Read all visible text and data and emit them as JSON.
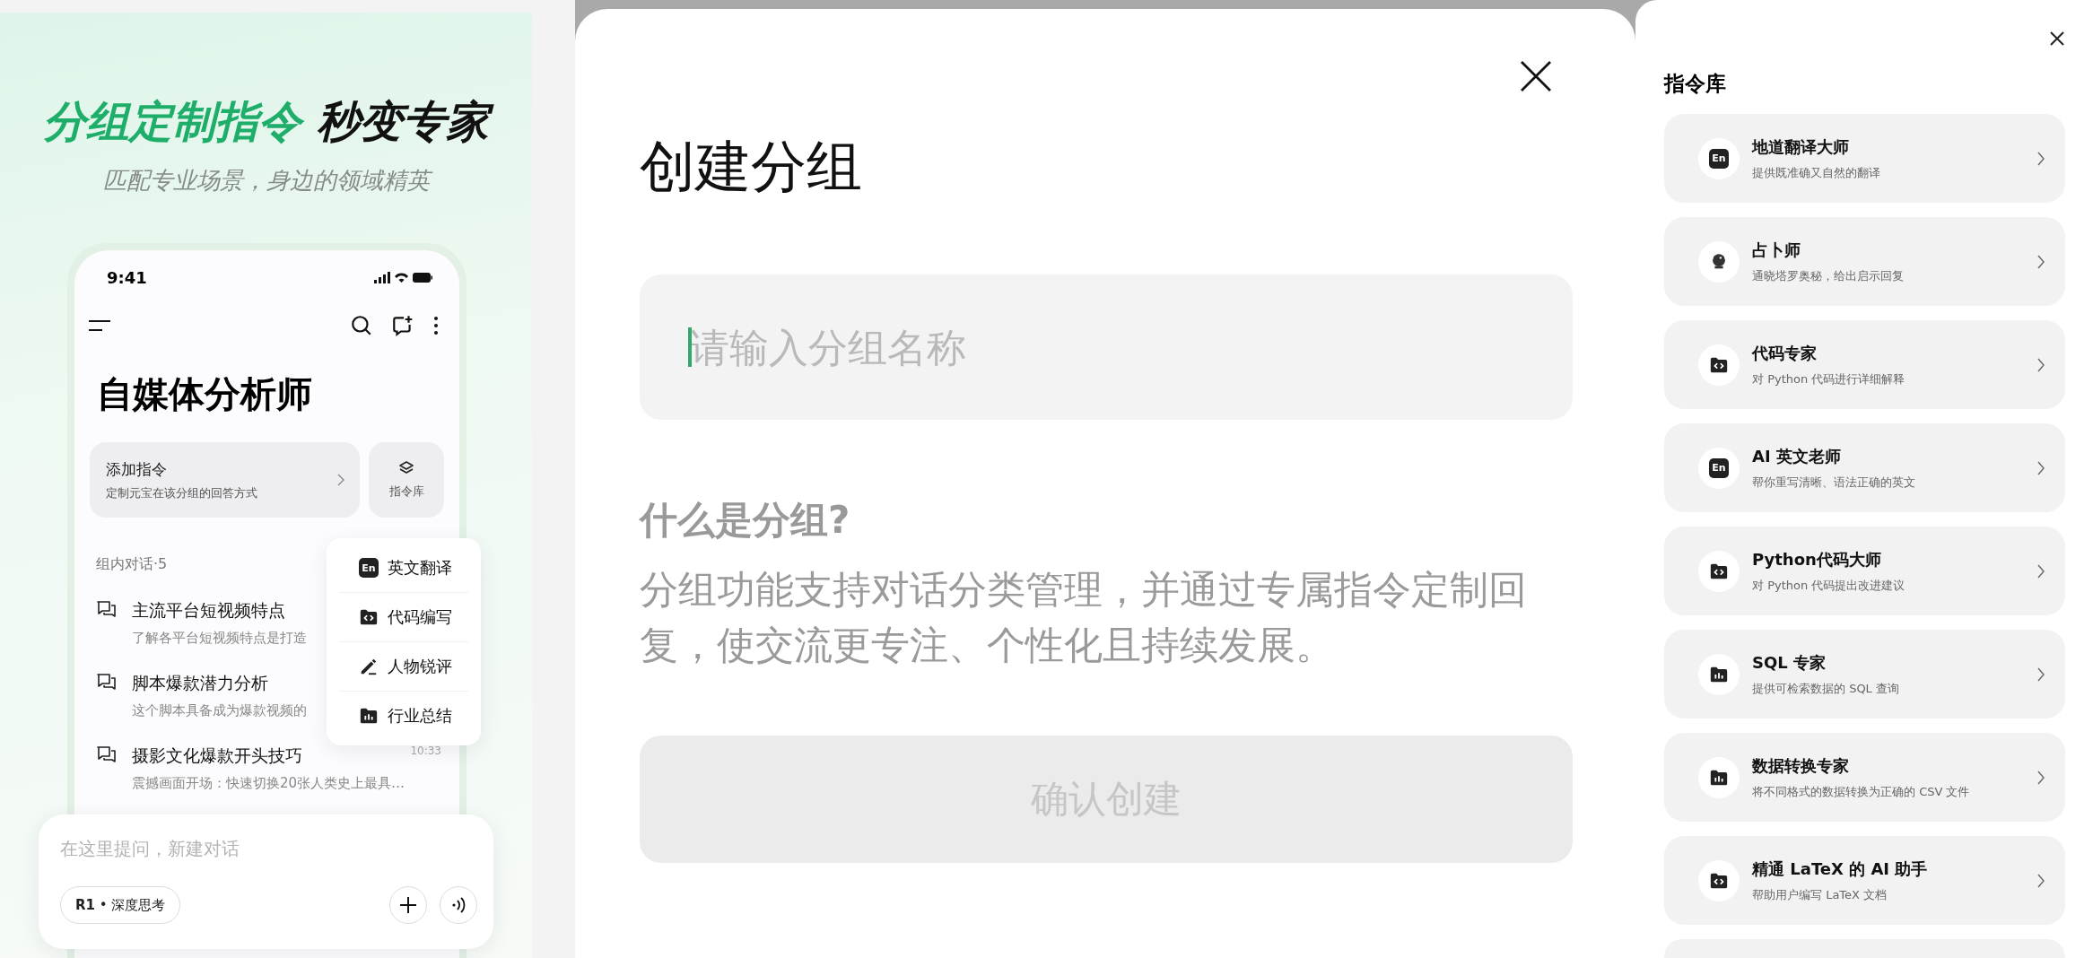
{
  "promo": {
    "headline_highlight": "分组定制指令",
    "headline_rest": "秒变专家",
    "subtitle": "匹配专业场景，身边的领域精英"
  },
  "phone": {
    "time": "9:41",
    "title": "自媒体分析师",
    "add_card": {
      "title": "添加指令",
      "subtitle": "定制元宝在该分组的回答方式"
    },
    "library_button": "指令库",
    "section_label": "组内对话·5",
    "conversations": [
      {
        "title": "主流平台短视频特点",
        "preview": "了解各平台短视频特点是打造"
      },
      {
        "title": "脚本爆款潜力分析",
        "preview": "这个脚本具备成为爆款视频的"
      },
      {
        "title": "摄影文化爆款开头技巧",
        "preview": "震撼画面开场：快速切换20张人类史上最具…",
        "time": "10:33"
      }
    ],
    "popup_menu": [
      {
        "kind": "en",
        "badge": "En",
        "label": "英文翻译"
      },
      {
        "kind": "code",
        "label": "代码编写"
      },
      {
        "kind": "pen",
        "label": "人物锐评"
      },
      {
        "kind": "chart",
        "label": "行业总结"
      }
    ],
    "composer": {
      "placeholder": "在这里提问，新建对话",
      "mode_chip": "**R1** • 深度思考"
    }
  },
  "sheet": {
    "title": "创建分组",
    "name_field": {
      "placeholder": "请输入分组名称"
    },
    "help_heading": "什么是分组?",
    "help_text": "分组功能支持对话分类管理，并通过专属指令定制回复，使交流更专注、个性化且持续发展。",
    "confirm_button": {
      "label": "确认创建",
      "disabled": true
    }
  },
  "library": {
    "title": "指令库",
    "items": [
      {
        "kind": "en",
        "badge": "En",
        "title": "地道翻译大师",
        "subtitle": "提供既准确又自然的翻译"
      },
      {
        "kind": "ball",
        "title": "占卜师",
        "subtitle": "通晓塔罗奥秘，给出启示回复"
      },
      {
        "kind": "code",
        "title": "代码专家",
        "subtitle": "对 Python 代码进行详细解释"
      },
      {
        "kind": "en",
        "badge": "En",
        "title": "AI 英文老师",
        "subtitle": "帮你重写清晰、语法正确的英文"
      },
      {
        "kind": "code",
        "title": "Python代码大师",
        "subtitle": "对 Python 代码提出改进建议"
      },
      {
        "kind": "chart",
        "title": "SQL 专家",
        "subtitle": "提供可检索数据的 SQL 查询"
      },
      {
        "kind": "chart",
        "title": "数据转换专家",
        "subtitle": "将不同格式的数据转换为正确的 CSV 文件"
      },
      {
        "kind": "code",
        "title": "精通 LaTeX 的 AI 助手",
        "subtitle": "帮助用户编写 LaTeX 文档"
      }
    ]
  }
}
